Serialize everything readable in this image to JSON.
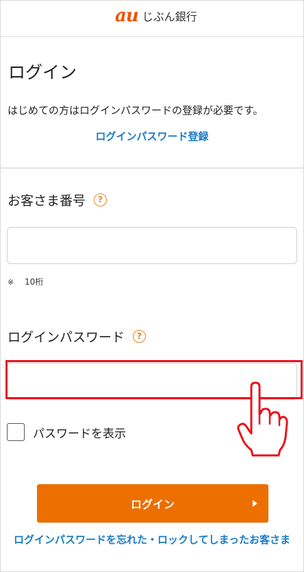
{
  "header": {
    "brand_mark": "au",
    "brand_name": "じぶん銀行"
  },
  "page": {
    "title": "ログイン",
    "intro": "はじめての方はログインパスワードの登録が必要です。",
    "register_link": "ログインパスワード登録"
  },
  "customer_number": {
    "label": "お客さま番号",
    "help_icon": "?",
    "note_mark": "※",
    "note": "10桁"
  },
  "password": {
    "label": "ログインパスワード",
    "help_icon": "?"
  },
  "show_password": {
    "label": "パスワードを表示",
    "checked": false
  },
  "login_button": {
    "label": "ログイン"
  },
  "forgot_link": "ログインパスワードを忘れた・ロックしてしまったお客さま",
  "colors": {
    "accent_orange": "#ec6f00",
    "link_blue": "#1a7cc6",
    "highlight_red": "#e8131c"
  },
  "icons": [
    "help-circle-icon",
    "pointing-hand-icon",
    "play-arrow-icon"
  ]
}
